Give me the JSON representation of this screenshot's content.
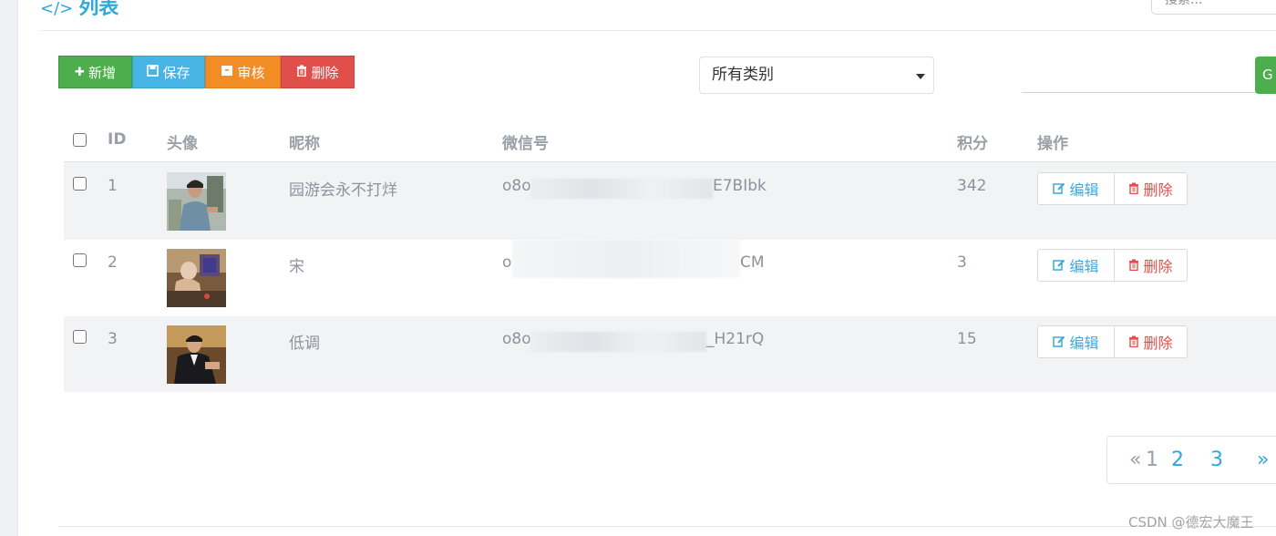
{
  "page": {
    "title": "列表",
    "code_icon": "</>"
  },
  "search": {
    "placeholder": "搜索..."
  },
  "toolbar": {
    "add_label": "新增",
    "add_icon": "plus-icon",
    "save_label": "保存",
    "save_icon": "floppy-icon",
    "audit_label": "审核",
    "audit_icon": "archive-icon",
    "delete_label": "删除",
    "delete_icon": "trash-icon"
  },
  "filter": {
    "category_selected": "所有类别",
    "go_label": "G"
  },
  "table": {
    "headers": {
      "id": "ID",
      "avatar": "头像",
      "nickname": "昵称",
      "wechat": "微信号",
      "points": "积分",
      "actions": "操作"
    },
    "rows": [
      {
        "id": "1",
        "nickname": "园游会永不打烊",
        "wechat_prefix": "o8o",
        "wechat_suffix": "E7BIbk",
        "points": "342",
        "edit_label": "编辑",
        "delete_label": "删除"
      },
      {
        "id": "2",
        "nickname": "宋",
        "wechat_prefix": "o",
        "wechat_suffix": "CM",
        "points": "3",
        "edit_label": "编辑",
        "delete_label": "删除"
      },
      {
        "id": "3",
        "nickname": "低调",
        "wechat_prefix": "o8o",
        "wechat_suffix": "_H21rQ",
        "points": "15",
        "edit_label": "编辑",
        "delete_label": "删除"
      }
    ]
  },
  "pagination": {
    "prev": "«",
    "current": "1",
    "pages": [
      "2",
      "3"
    ],
    "next": "»"
  },
  "watermark": "CSDN @德宏大魔王",
  "colors": {
    "accent_blue": "#2fa9d8",
    "green": "#4cae4c",
    "sky": "#47b4e6",
    "orange": "#f28c25",
    "red": "#e04f4a"
  }
}
